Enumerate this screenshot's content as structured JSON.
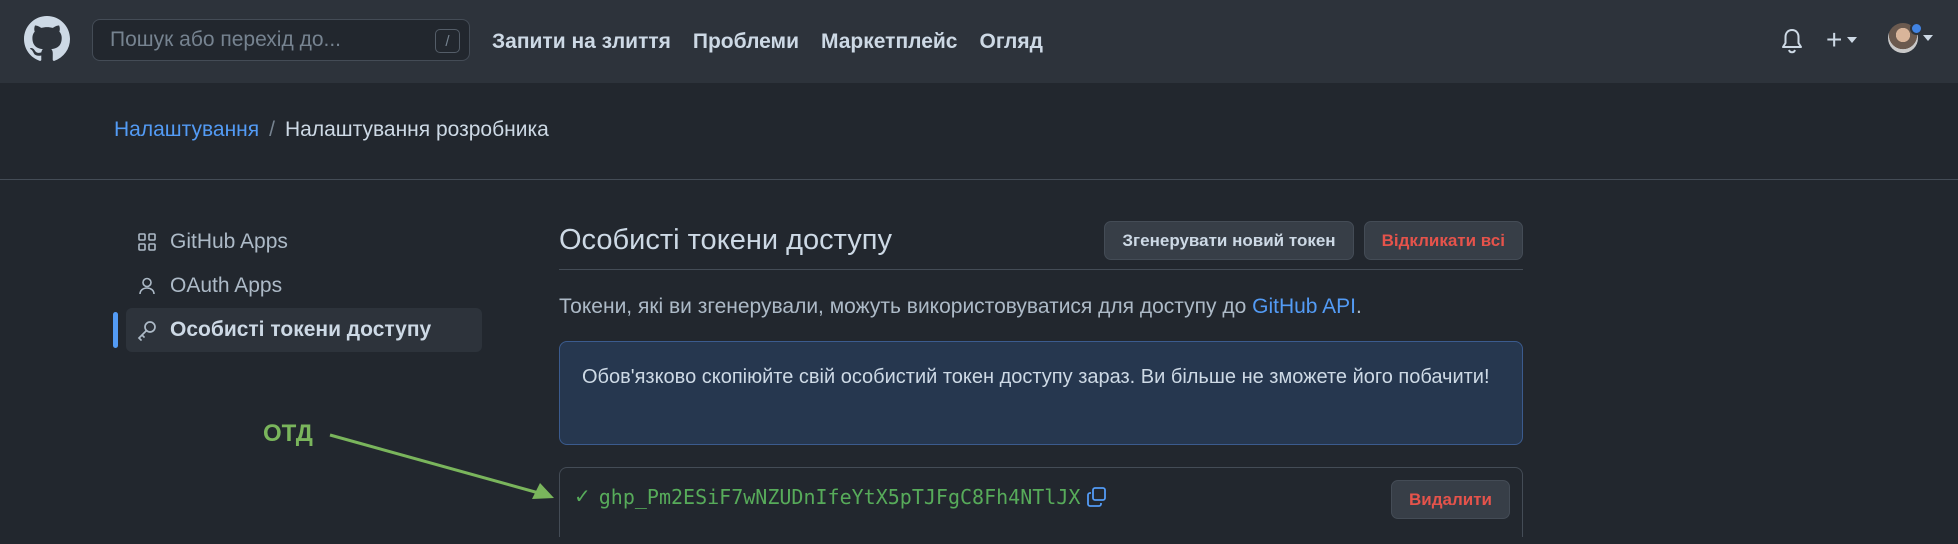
{
  "header": {
    "search_placeholder": "Пошук або перехід до...",
    "search_hint": "/",
    "nav": [
      "Запити на злиття",
      "Проблеми",
      "Маркетплейс",
      "Огляд"
    ]
  },
  "breadcrumb": {
    "parent": "Налаштування",
    "separator": "/",
    "current": "Налаштування розробника"
  },
  "sidebar": {
    "items": [
      {
        "label": "GitHub Apps",
        "icon": "apps-grid-icon"
      },
      {
        "label": "OAuth Apps",
        "icon": "person-icon"
      },
      {
        "label": "Особисті токени доступу",
        "icon": "key-icon"
      }
    ]
  },
  "main": {
    "title": "Особисті токени доступу",
    "generate_button": "Згенерувати новий токен",
    "revoke_button": "Відкликати всі",
    "description_prefix": "Токени, які ви згенерували, можуть використовуватися для доступу до ",
    "description_link": "GitHub API",
    "description_suffix": ".",
    "flash_message": "Обов'язково скопіюйте свій особистий токен доступу зараз. Ви більше не зможете його побачити!",
    "token_value": "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",
    "delete_button": "Видалити"
  },
  "annotation": {
    "label": "ОТД"
  },
  "colors": {
    "background": "#22272e",
    "header": "#2d333b",
    "link": "#539bf5",
    "danger": "#e5534b",
    "success": "#57ab5a",
    "annotation": "#7ab55c"
  }
}
